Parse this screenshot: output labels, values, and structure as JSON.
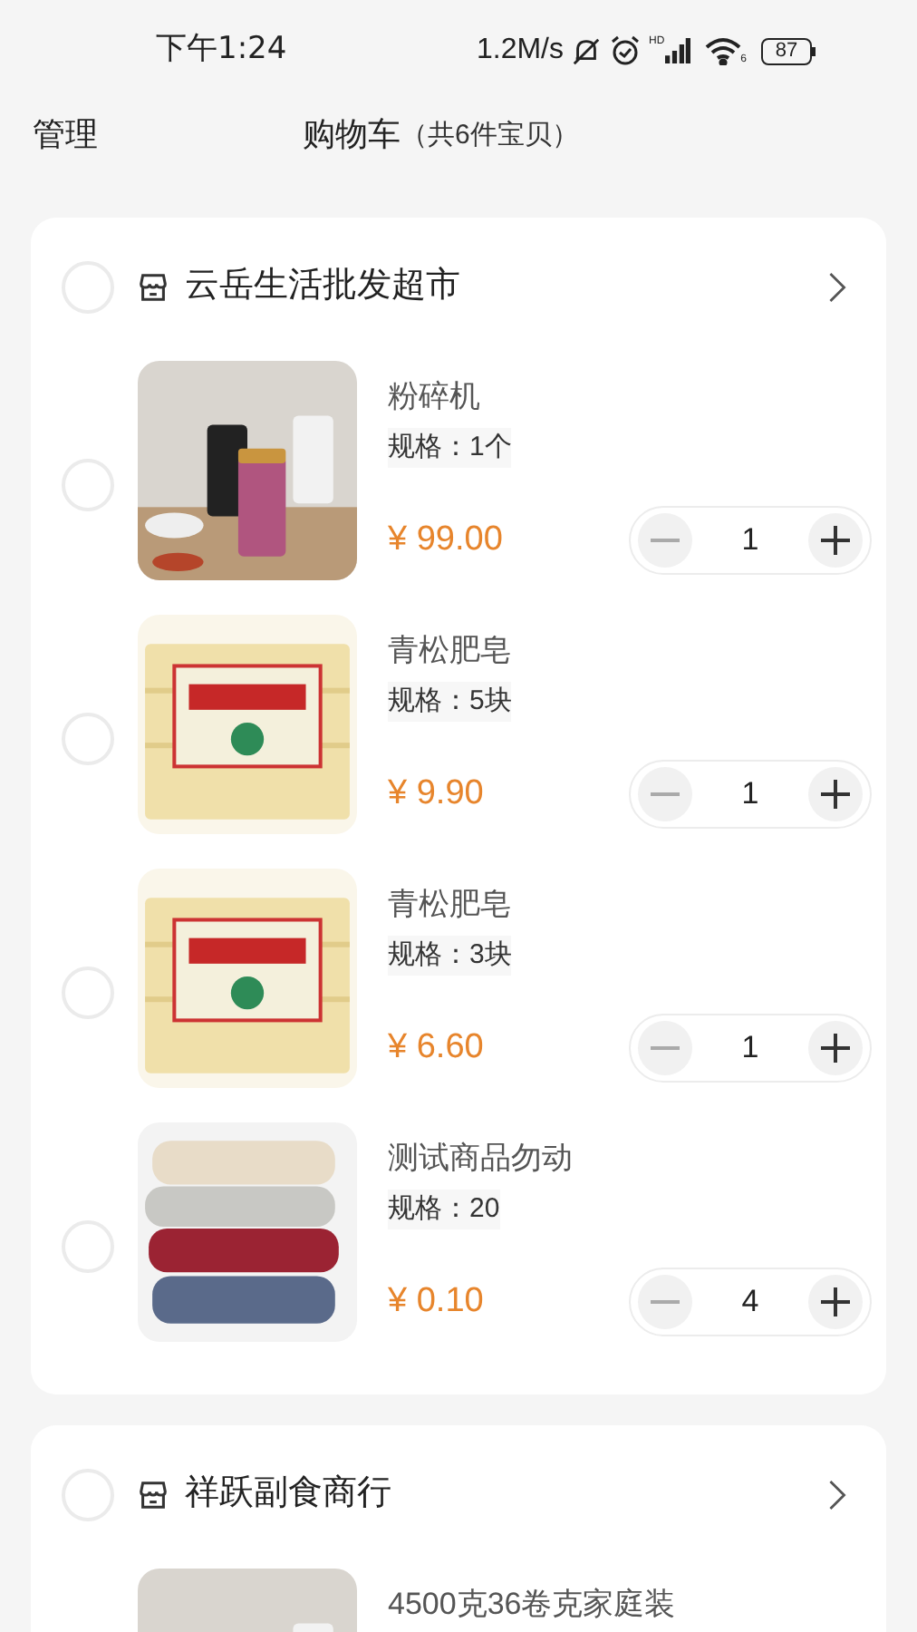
{
  "status_bar": {
    "time": "下午1:24",
    "speed": "1.2M/s",
    "signal_label": "HD",
    "wifi_label": "6",
    "battery": "87"
  },
  "header": {
    "manage": "管理",
    "title": "购物车",
    "count": "（共6件宝贝）"
  },
  "shops": [
    {
      "name": "云岳生活批发超市",
      "selected": false,
      "items": [
        {
          "kind": "picture",
          "name": "粉碎机",
          "spec": "规格：1个",
          "price": "¥ 99.00",
          "quantity": "1",
          "selected": false
        },
        {
          "kind": "picture",
          "name": "青松肥皂",
          "spec": "规格：5块",
          "price": "¥ 9.90",
          "quantity": "1",
          "selected": false
        },
        {
          "kind": "picture",
          "name": "青松肥皂",
          "spec": "规格：3块",
          "price": "¥ 6.60",
          "quantity": "1",
          "selected": false
        },
        {
          "kind": "picture",
          "name": "测试商品勿动",
          "spec": "规格：20",
          "price": "¥ 0.10",
          "quantity": "4",
          "selected": false
        }
      ]
    },
    {
      "name": "祥跃副食商行",
      "selected": false,
      "items": [
        {
          "kind": "picture",
          "name": "4500克36卷克家庭装"
        }
      ]
    }
  ]
}
